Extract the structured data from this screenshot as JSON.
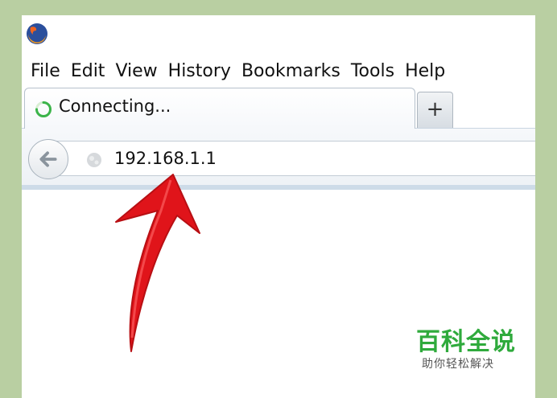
{
  "menu": {
    "items": [
      {
        "label": "File"
      },
      {
        "label": "Edit"
      },
      {
        "label": "View"
      },
      {
        "label": "History"
      },
      {
        "label": "Bookmarks"
      },
      {
        "label": "Tools"
      },
      {
        "label": "Help"
      }
    ]
  },
  "tab": {
    "title": "Connecting..."
  },
  "new_tab": {
    "label": "+"
  },
  "address_bar": {
    "value": "192.168.1.1"
  },
  "watermark": {
    "title": "百科全说",
    "subtitle": "助你轻松解决"
  },
  "colors": {
    "background": "#b9cfa2",
    "arrow": "#e0141a",
    "watermark": "#2faa3c"
  },
  "icons": [
    "firefox-logo-icon",
    "loading-spinner-icon",
    "back-arrow-icon",
    "globe-icon"
  ]
}
